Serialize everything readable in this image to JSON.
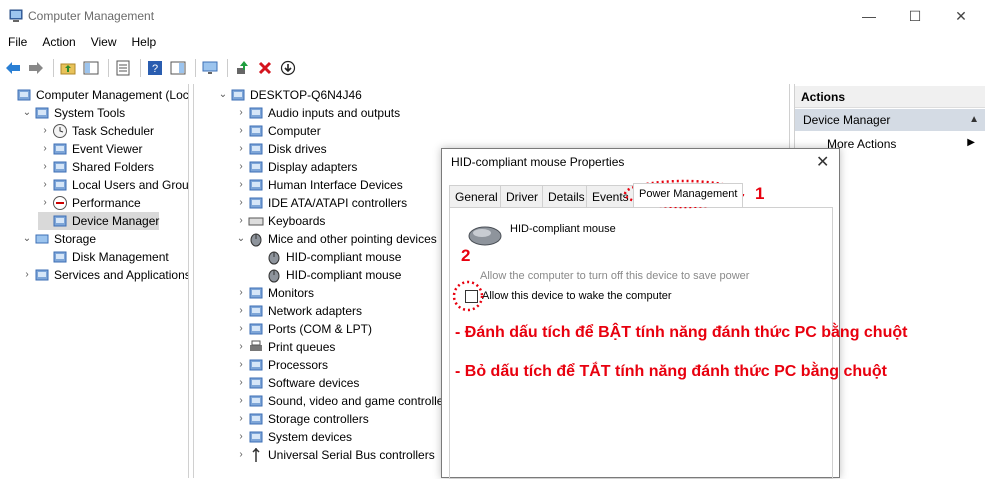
{
  "window": {
    "title": "Computer Management",
    "controls": {
      "minimize": "—",
      "maximize": "☐",
      "close": "✕"
    }
  },
  "menu": [
    "File",
    "Action",
    "View",
    "Help"
  ],
  "left_tree": [
    {
      "label": "Computer Management (Local",
      "icon": "computer-management-icon",
      "twisty": "",
      "indent": 0
    },
    {
      "label": "System Tools",
      "icon": "system-tools-icon",
      "twisty": "⌄",
      "indent": 1
    },
    {
      "label": "Task Scheduler",
      "icon": "clock-icon",
      "twisty": "›",
      "indent": 2
    },
    {
      "label": "Event Viewer",
      "icon": "event-viewer-icon",
      "twisty": "›",
      "indent": 2
    },
    {
      "label": "Shared Folders",
      "icon": "shared-folder-icon",
      "twisty": "›",
      "indent": 2
    },
    {
      "label": "Local Users and Groups",
      "icon": "users-icon",
      "twisty": "›",
      "indent": 2
    },
    {
      "label": "Performance",
      "icon": "performance-icon",
      "twisty": "›",
      "indent": 2
    },
    {
      "label": "Device Manager",
      "icon": "device-manager-icon",
      "twisty": "",
      "indent": 2,
      "selected": true
    },
    {
      "label": "Storage",
      "icon": "storage-icon",
      "twisty": "⌄",
      "indent": 1
    },
    {
      "label": "Disk Management",
      "icon": "disk-management-icon",
      "twisty": "",
      "indent": 2
    },
    {
      "label": "Services and Applications",
      "icon": "services-icon",
      "twisty": "›",
      "indent": 1
    }
  ],
  "device_tree": [
    {
      "label": "DESKTOP-Q6N4J46",
      "icon": "computer-icon",
      "twisty": "⌄",
      "indent": 0
    },
    {
      "label": "Audio inputs and outputs",
      "icon": "audio-icon",
      "twisty": "›",
      "indent": 1
    },
    {
      "label": "Computer",
      "icon": "monitor-icon",
      "twisty": "›",
      "indent": 1
    },
    {
      "label": "Disk drives",
      "icon": "disk-drive-icon",
      "twisty": "›",
      "indent": 1
    },
    {
      "label": "Display adapters",
      "icon": "display-adapter-icon",
      "twisty": "›",
      "indent": 1
    },
    {
      "label": "Human Interface Devices",
      "icon": "hid-icon",
      "twisty": "›",
      "indent": 1
    },
    {
      "label": "IDE ATA/ATAPI controllers",
      "icon": "ide-controller-icon",
      "twisty": "›",
      "indent": 1
    },
    {
      "label": "Keyboards",
      "icon": "keyboard-icon",
      "twisty": "›",
      "indent": 1
    },
    {
      "label": "Mice and other pointing devices",
      "icon": "mouse-icon",
      "twisty": "⌄",
      "indent": 1
    },
    {
      "label": "HID-compliant mouse",
      "icon": "mouse-icon",
      "twisty": "",
      "indent": 2
    },
    {
      "label": "HID-compliant mouse",
      "icon": "mouse-icon",
      "twisty": "",
      "indent": 2
    },
    {
      "label": "Monitors",
      "icon": "monitor-icon",
      "twisty": "›",
      "indent": 1
    },
    {
      "label": "Network adapters",
      "icon": "network-adapter-icon",
      "twisty": "›",
      "indent": 1
    },
    {
      "label": "Ports (COM & LPT)",
      "icon": "port-icon",
      "twisty": "›",
      "indent": 1
    },
    {
      "label": "Print queues",
      "icon": "printer-icon",
      "twisty": "›",
      "indent": 1
    },
    {
      "label": "Processors",
      "icon": "processor-icon",
      "twisty": "›",
      "indent": 1
    },
    {
      "label": "Software devices",
      "icon": "software-device-icon",
      "twisty": "›",
      "indent": 1
    },
    {
      "label": "Sound, video and game controllers",
      "icon": "sound-icon",
      "twisty": "›",
      "indent": 1
    },
    {
      "label": "Storage controllers",
      "icon": "storage-controller-icon",
      "twisty": "›",
      "indent": 1
    },
    {
      "label": "System devices",
      "icon": "system-devices-icon",
      "twisty": "›",
      "indent": 1
    },
    {
      "label": "Universal Serial Bus controllers",
      "icon": "usb-icon",
      "twisty": "›",
      "indent": 1
    }
  ],
  "actions": {
    "header": "Actions",
    "section": "Device Manager",
    "more": "More Actions"
  },
  "dialog": {
    "title": "HID-compliant mouse Properties",
    "tabs": [
      "General",
      "Driver",
      "Details",
      "Events",
      "Power Management"
    ],
    "active_tab": "Power Management",
    "device_name": "HID-compliant mouse",
    "option_turnoff": "Allow the computer to turn off this device to save power",
    "option_wake": "Allow this device to wake the computer",
    "wake_checked": false
  },
  "annotations": {
    "marker_1": "1",
    "marker_2": "2",
    "note_on": "-  Đánh dấu tích để BẬT tính năng đánh thức PC bằng chuột",
    "note_off": "-  Bỏ dấu tích để TẮT tính năng đánh thức PC bằng chuột",
    "color": "#e8000e"
  }
}
